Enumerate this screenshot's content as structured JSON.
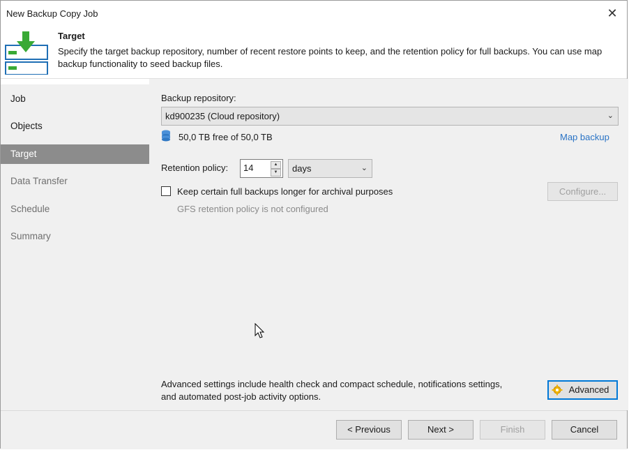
{
  "window": {
    "title": "New Backup Copy Job",
    "close_symbol": "✕"
  },
  "header": {
    "title": "Target",
    "description": "Specify the target backup repository, number of recent restore points to keep, and the retention policy for full backups. You can use map backup functionality to seed backup files.",
    "icon": "backup-target-icon",
    "accent": "#39a935"
  },
  "sidebar": {
    "items": [
      {
        "label": "Job",
        "state": "enabled"
      },
      {
        "label": "Objects",
        "state": "enabled"
      },
      {
        "label": "Target",
        "state": "active"
      },
      {
        "label": "Data Transfer",
        "state": "disabled"
      },
      {
        "label": "Schedule",
        "state": "disabled"
      },
      {
        "label": "Summary",
        "state": "disabled"
      }
    ]
  },
  "target": {
    "repository_label": "Backup repository:",
    "repository_value": "kd900235 (Cloud repository)",
    "free_space": "50,0 TB free of 50,0 TB",
    "map_backup_link": "Map backup",
    "retention_label": "Retention policy:",
    "retention_value": "14",
    "retention_unit": "days",
    "archival_checkbox_label": "Keep certain full backups longer for archival purposes",
    "archival_checked": false,
    "gfs_status": "GFS retention policy is not configured",
    "configure_button": "Configure...",
    "advanced_text_line1": "Advanced settings include health check and compact schedule, notifications settings,",
    "advanced_text_line2": "and automated post-job activity options.",
    "advanced_button": "Advanced"
  },
  "footer": {
    "previous": "< Previous",
    "next": "Next >",
    "finish": "Finish",
    "cancel": "Cancel"
  }
}
